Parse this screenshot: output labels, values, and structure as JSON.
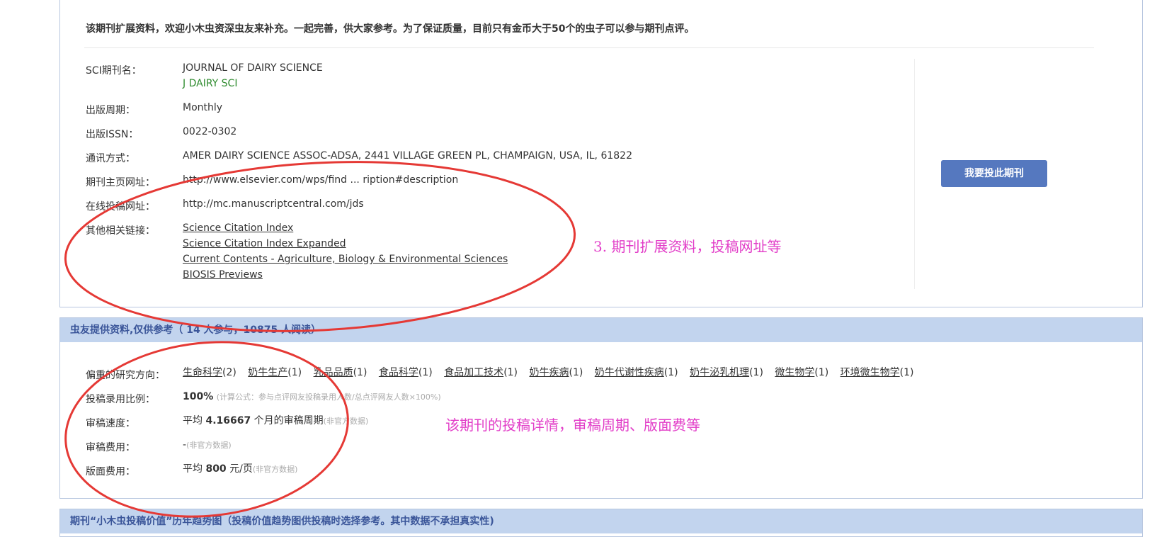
{
  "notice": "该期刊扩展资料，欢迎小木虫资深虫友来补充。一起完善，供大家参考。为了保证质量，目前只有金币大于50个的虫子可以参与期刊点评。",
  "journal": {
    "name_label": "SCI期刊名：",
    "name": "JOURNAL OF DAIRY SCIENCE",
    "abbr": "J DAIRY SCI",
    "period_label": "出版周期：",
    "period": "Monthly",
    "issn_label": "出版ISSN：",
    "issn": "0022-0302",
    "contact_label": "通讯方式：",
    "contact": "AMER DAIRY SCIENCE ASSOC-ADSA, 2441 VILLAGE GREEN PL, CHAMPAIGN, USA, IL, 61822",
    "homepage_label": "期刊主页网址：",
    "homepage": "http://www.elsevier.com/wps/find ... ription#description",
    "submit_url_label": "在线投稿网址：",
    "submit_url": "http://mc.manuscriptcentral.com/jds",
    "links_label": "其他相关链接：",
    "links": [
      "Science Citation Index",
      "Science Citation Index Expanded",
      "Current Contents - Agriculture, Biology & Environmental Sciences",
      "BIOSIS Previews"
    ]
  },
  "submit_button": "我要投此期刊",
  "annotation_1": "3. 期刊扩展资料，投稿网址等",
  "user_info": {
    "header_title": "虫友提供资料,仅供参考",
    "header_count": "（ 14 人参与，10875 人阅读）",
    "research_label": "偏重的研究方向：",
    "research_tags": [
      {
        "name": "生命科学",
        "count": "(2)"
      },
      {
        "name": "奶牛生产",
        "count": "(1)"
      },
      {
        "name": "乳品品质",
        "count": "(1)"
      },
      {
        "name": "食品科学",
        "count": "(1)"
      },
      {
        "name": "食品加工技术",
        "count": "(1)"
      },
      {
        "name": "奶牛疾病",
        "count": "(1)"
      },
      {
        "name": "奶牛代谢性疾病",
        "count": "(1)"
      },
      {
        "name": "奶牛泌乳机理",
        "count": "(1)"
      },
      {
        "name": "微生物学",
        "count": "(1)"
      },
      {
        "name": "环境微生物学",
        "count": "(1)"
      }
    ],
    "accept_label": "投稿录用比例：",
    "accept_value": "100%",
    "accept_note": "(计算公式：参与点评网友投稿录用人数/总点评网友人数×100%)",
    "speed_label": "审稿速度：",
    "speed_prefix": "平均",
    "speed_value": "4.16667",
    "speed_suffix": "个月的审稿周期",
    "speed_note": "(非官方数据)",
    "review_fee_label": "审稿费用：",
    "review_fee": "-",
    "review_fee_note": "(非官方数据)",
    "page_fee_label": "版面费用：",
    "page_fee_prefix": "平均",
    "page_fee_value": "800",
    "page_fee_suffix": "元/页",
    "page_fee_note": "(非官方数据)"
  },
  "annotation_2": "该期刊的投稿详情，审稿周期、版面费等",
  "trend_header": "期刊“小木虫投稿价值”历年趋势图（投稿价值趋势图供投稿时选择参考。其中数据不承担真实性)",
  "colors": {
    "accent": "#5578bf",
    "header_bg": "#c2d4ee",
    "annotation": "#e23ec8",
    "circle": "#e53935",
    "abbr_green": "#2e8b2e"
  }
}
